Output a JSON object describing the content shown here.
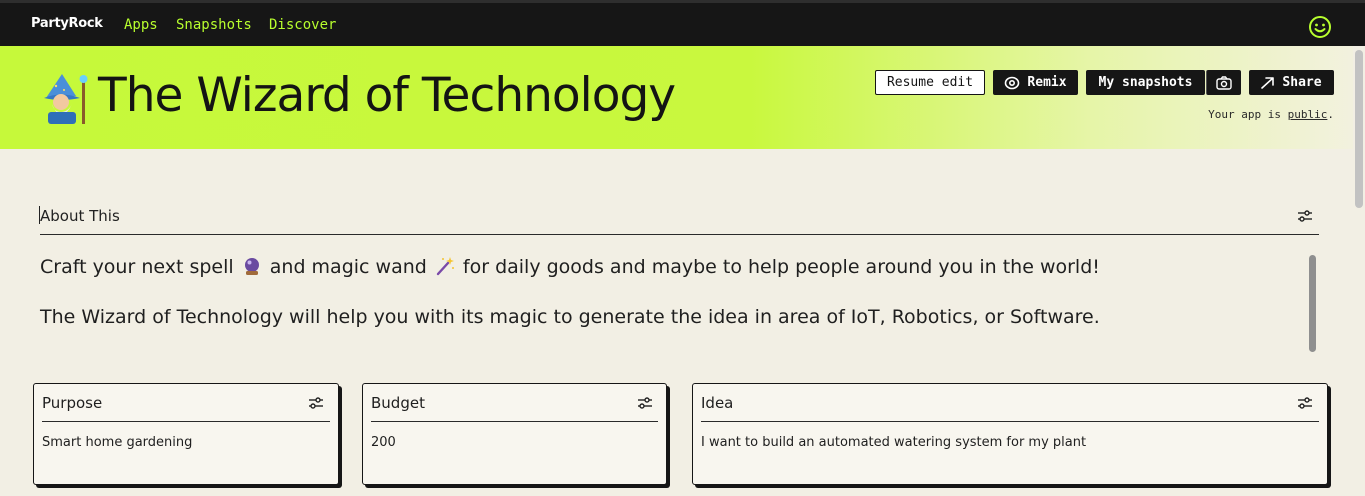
{
  "topbar": {
    "brand": "PartyRock",
    "nav": [
      "Apps",
      "Snapshots",
      "Discover"
    ],
    "profile_icon": "smiley-face-icon"
  },
  "header": {
    "emoji": "wizard-emoji",
    "title": "The Wizard of Technology",
    "buttons": {
      "resume_edit": "Resume edit",
      "remix": "Remix",
      "my_snapshots": "My snapshots",
      "share": "Share"
    },
    "visibility_prefix": "Your app is ",
    "visibility_link": "public",
    "visibility_suffix": "."
  },
  "about": {
    "title": "About This",
    "line1_part1": "Craft your next spell",
    "line1_part2": "and magic wand",
    "line1_part3": "for daily goods and maybe to help people around you in the world!",
    "line2": "The Wizard of Technology will help you with its magic to generate the idea in area of IoT, Robotics, or Software."
  },
  "cards": [
    {
      "title": "Purpose",
      "value": "Smart home gardening"
    },
    {
      "title": "Budget",
      "value": "200"
    },
    {
      "title": "Idea",
      "value": "I want to build an automated watering system for my plant"
    }
  ],
  "colors": {
    "accent_green": "#c6f93a",
    "nav_green": "#b8ff2e",
    "dark": "#161616",
    "background": "#f2efe4"
  }
}
